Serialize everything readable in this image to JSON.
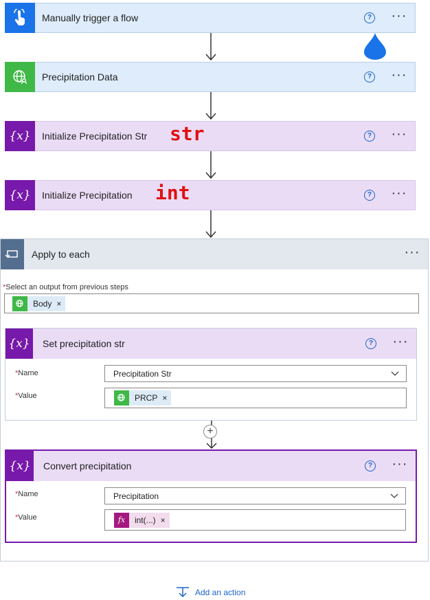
{
  "steps": [
    {
      "title": "Manually trigger a flow",
      "icon": "hand-touch-icon"
    },
    {
      "title": "Precipitation Data",
      "icon": "globe-person-icon"
    },
    {
      "title": "Initialize Precipitation Str",
      "icon": "variable-icon",
      "annotation": "str"
    },
    {
      "title": "Initialize Precipitation",
      "icon": "variable-icon",
      "annotation": "int"
    }
  ],
  "help_glyph": "?",
  "more_glyph": "···",
  "apply": {
    "title": "Apply to each",
    "select_label": "Select an output from previous steps",
    "select_token": "Body"
  },
  "set_str": {
    "title": "Set precipitation str",
    "name_label": "Name",
    "name_value": "Precipitation Str",
    "value_label": "Value",
    "value_token": "PRCP"
  },
  "convert": {
    "title": "Convert precipitation",
    "name_label": "Name",
    "name_value": "Precipitation",
    "value_label": "Value",
    "value_token": "int(...)"
  },
  "add_action": "Add an action",
  "required_mark": "*",
  "close_glyph": "×",
  "colors": {
    "trigger_blue": "#1a73e8",
    "connector_green": "#3fb847",
    "variable_purple": "#7719aa",
    "loop_slate": "#546e8f",
    "annotation_red": "#e01010",
    "link_blue": "#1a64c8"
  }
}
